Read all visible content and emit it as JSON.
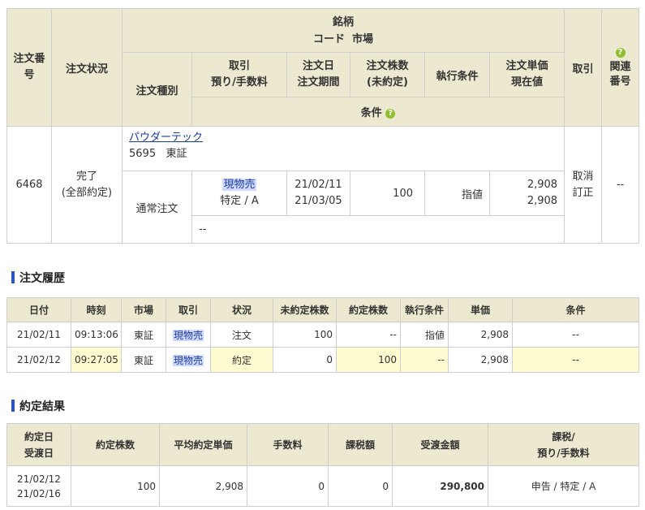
{
  "order": {
    "headers": {
      "order_no": "注文番号",
      "status": "注文状況",
      "meigara": "銘柄",
      "code_market": "コード  市場",
      "order_type": "注文種別",
      "trade": "取引",
      "deposit_fee": "預り/手数料",
      "order_date": "注文日",
      "order_period": "注文期間",
      "qty": "注文株数",
      "unfilled": "(未約定)",
      "exec_cond": "執行条件",
      "unit_price": "注文単価",
      "current_price": "現在値",
      "cancel": "取引",
      "related": "関連番号",
      "conditions": "条件"
    },
    "row": {
      "order_no": "6468",
      "status_line1": "完了",
      "status_line2": "(全部約定)",
      "stock_name": "パウダーテック",
      "stock_code_market": "5695   東証",
      "order_type": "通常注文",
      "trade": "現物売",
      "deposit_fee": "特定 / A",
      "order_date": "21/02/11",
      "order_period": "21/03/05",
      "qty": "100",
      "exec_cond": "指値",
      "unit_price": "2,908",
      "current_price": "2,908",
      "cancel": "取消",
      "modify": "訂正",
      "related": "--",
      "conditions": "--"
    }
  },
  "history": {
    "title": "注文履歴",
    "columns": [
      "日付",
      "時刻",
      "市場",
      "取引",
      "状況",
      "未約定株数",
      "約定株数",
      "執行条件",
      "単価",
      "条件"
    ],
    "rows": [
      [
        "21/02/11",
        "09:13:06",
        "東証",
        "現物売",
        "注文",
        "100",
        "--",
        "指値",
        "2,908",
        "--"
      ],
      [
        "21/02/12",
        "09:27:05",
        "東証",
        "現物売",
        "約定",
        "0",
        "100",
        "--",
        "2,908",
        "--"
      ]
    ]
  },
  "result": {
    "title": "約定結果",
    "columns": {
      "date1": "約定日",
      "date2": "受渡日",
      "qty": "約定株数",
      "avg_price": "平均約定単価",
      "fee": "手数料",
      "tax": "課税額",
      "amount": "受渡金額",
      "tax_fee1": "課税/",
      "tax_fee2": "預り/手数料"
    },
    "row": {
      "date1": "21/02/12",
      "date2": "21/02/16",
      "qty": "100",
      "avg_price": "2,908",
      "fee": "0",
      "tax": "0",
      "amount": "290,800",
      "tax_fee": "申告 / 特定 / A"
    }
  },
  "colors": {
    "header_bg": "#ece9d0",
    "highlight_row": "#fffbd0",
    "section_bar": "#2c55c7",
    "help_icon": "#8fbf2f"
  }
}
